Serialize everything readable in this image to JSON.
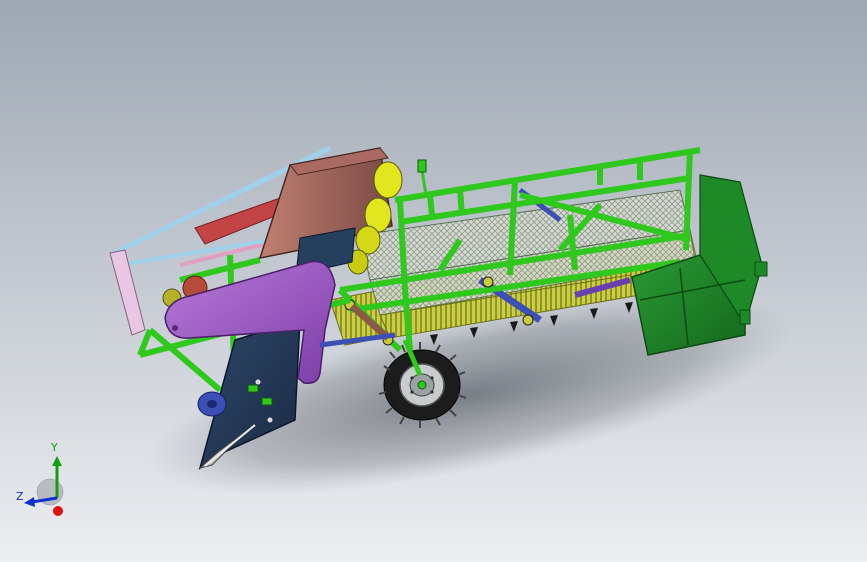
{
  "viewport": {
    "background_top": "#9ea7b3",
    "background_bottom": "#eceef1"
  },
  "triad": {
    "y_label": "Y",
    "z_label": "Z",
    "x_color": "#e01010",
    "y_color": "#10a010",
    "z_color": "#1030d0"
  },
  "model": {
    "frame_color": "#32d21e",
    "hopper_color": "#1e8a28",
    "conveyor_color": "#c8cc3c",
    "roller_color": "#e2e61e",
    "guard_color": "#9a4fc0",
    "cover_color": "#a0605a",
    "blue_part_color": "#3c4fb4",
    "tire_color": "#1c1c1c"
  }
}
